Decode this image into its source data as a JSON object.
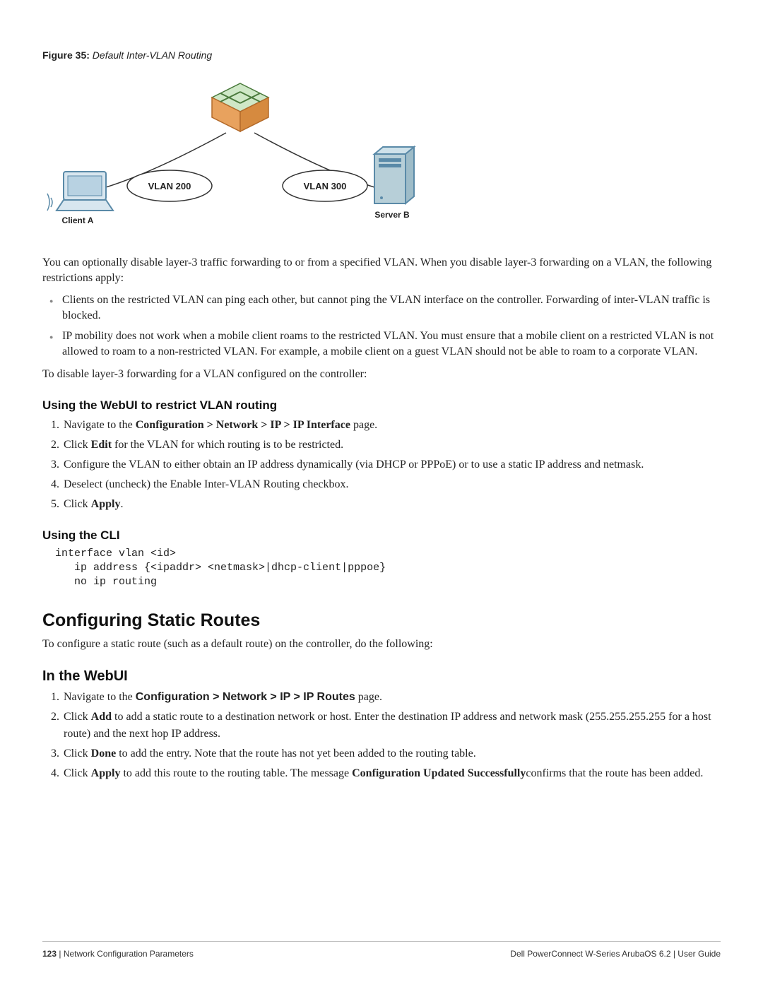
{
  "figure": {
    "label": "Figure 35:",
    "title": "Default Inter-VLAN Routing",
    "vlan_left": "VLAN 200",
    "vlan_right": "VLAN 300",
    "client_label": "Client A",
    "server_label": "Server B"
  },
  "para": {
    "intro": "You can optionally disable layer-3 traffic forwarding to or from a specified VLAN. When you disable layer-3 forwarding on a VLAN, the following restrictions apply:",
    "disable_intro": "To disable layer-3 forwarding for a VLAN configured on the controller:",
    "static_intro": "To configure a static route (such as a default route) on the controller, do the following:"
  },
  "bullets": {
    "b1": "Clients on the restricted VLAN can ping each other, but cannot ping the VLAN interface on the controller. Forwarding of inter-VLAN traffic is blocked.",
    "b2": "IP mobility does not work when a mobile client roams to the restricted VLAN. You must ensure that a mobile client on a restricted VLAN is not allowed to roam to a non-restricted VLAN. For example, a mobile client on a guest VLAN should not be able to roam to a corporate VLAN."
  },
  "headings": {
    "webui_restrict": "Using the WebUI to restrict VLAN routing",
    "using_cli": "Using the CLI",
    "config_static": "Configuring Static Routes",
    "in_webui": "In the WebUI"
  },
  "steps_webui": {
    "s1_pre": "Navigate to the ",
    "s1_bold": "Configuration > Network > IP > IP Interface",
    "s1_post": " page.",
    "s2_pre": "Click ",
    "s2_bold": "Edit",
    "s2_post": " for the VLAN for which routing is to be restricted.",
    "s3": "Configure the VLAN to either obtain an IP address dynamically (via DHCP or PPPoE) or to use a static IP address and netmask.",
    "s4": "Deselect (uncheck) the Enable Inter-VLAN Routing checkbox.",
    "s5_pre": "Click ",
    "s5_bold": "Apply",
    "s5_post": "."
  },
  "cli": "interface vlan <id>\n   ip address {<ipaddr> <netmask>|dhcp-client|pppoe}\n   no ip routing",
  "steps_static": {
    "s1_pre": "Navigate to the ",
    "s1_bold": "Configuration > Network > IP > IP Routes",
    "s1_post": " page.",
    "s2_pre": "Click ",
    "s2_bold": "Add",
    "s2_post": " to add a static route to a destination network or host. Enter the destination IP address and network mask (255.255.255.255 for a host route) and the next hop IP address.",
    "s3_pre": "Click ",
    "s3_bold": "Done",
    "s3_post": " to add the entry. Note that the route has not yet been added to the routing table.",
    "s4_pre": "Click ",
    "s4_bold1": "Apply",
    "s4_mid": " to add this route to the routing table. The message ",
    "s4_bold2": "Configuration Updated Successfully",
    "s4_post": "confirms that the route has been added."
  },
  "footer": {
    "page": "123",
    "sep": " | ",
    "chapter": "Network Configuration Parameters",
    "product": "Dell PowerConnect W-Series ArubaOS 6.2",
    "doc": "User Guide"
  }
}
